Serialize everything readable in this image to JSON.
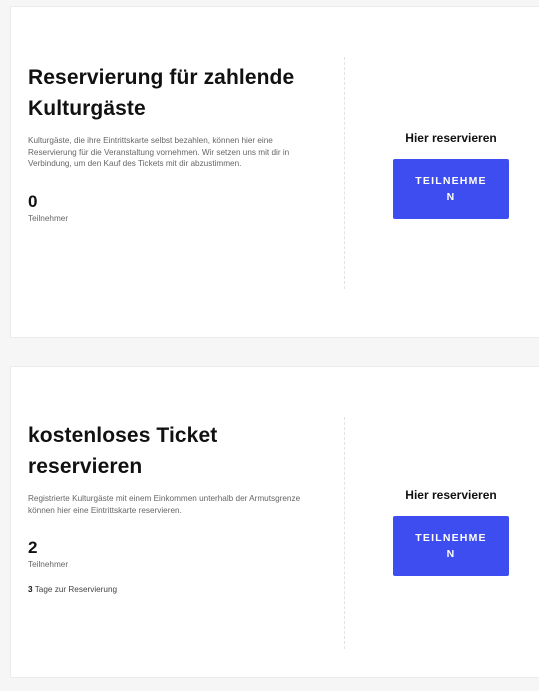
{
  "events": [
    {
      "title": "Reservierung für zahlende Kulturgäste",
      "description": "Kulturgäste, die ihre Eintrittskarte selbst bezahlen, können hier eine Reservierung für die Veranstaltung vornehmen. Wir setzen uns mit dir in Verbindung, um den Kauf des Tickets mit dir abzustimmen.",
      "participant_count": "0",
      "participant_label": "Teilnehmer",
      "cta_heading": "Hier reservieren",
      "button_label": "TEILNEHMEN"
    },
    {
      "title": "kostenloses Ticket reservieren",
      "description": "Registrierte Kulturgäste mit einem Einkommen unterhalb der Armutsgrenze können hier eine Eintrittskarte reservieren.",
      "participant_count": "2",
      "participant_label": "Teilnehmer",
      "days_count": "3",
      "days_label": "Tage zur Reservierung",
      "cta_heading": "Hier reservieren",
      "button_label": "TEILNEHMEN"
    }
  ],
  "colors": {
    "accent": "#3d4df0",
    "background": "#f6f6f6",
    "card": "#ffffff"
  }
}
